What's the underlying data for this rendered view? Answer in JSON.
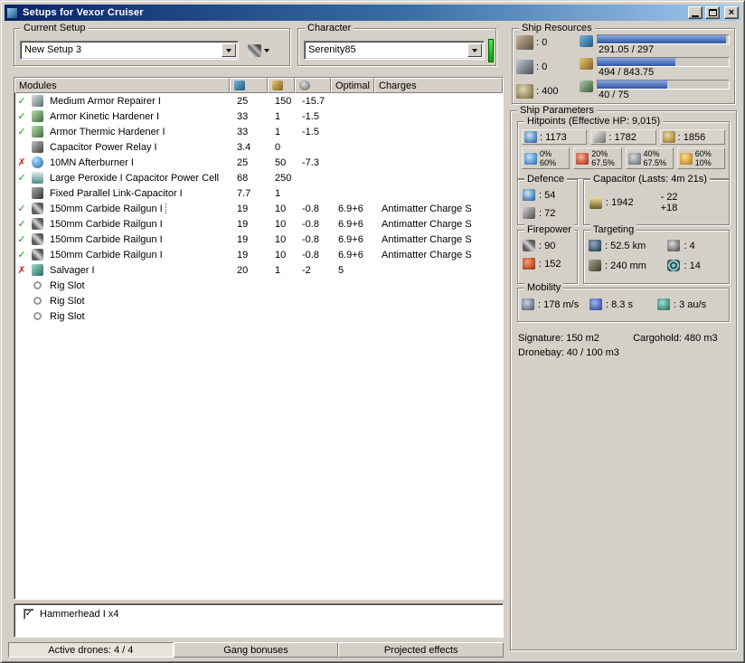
{
  "window": {
    "title": "Setups for Vexor Cruiser"
  },
  "toolbar": {
    "current_setup_label": "Current Setup",
    "current_setup_value": "New Setup 3",
    "character_label": "Character",
    "character_value": "Serenity85"
  },
  "modules": {
    "columns": {
      "name": "Modules",
      "cpu_icon": "cpu-icon",
      "pg_icon": "powergrid-icon",
      "cap_icon": "capacitor-col-icon",
      "optimal": "Optimal",
      "charges": "Charges"
    },
    "rows": [
      {
        "status": "on",
        "icon": "armor-repairer-icon",
        "name": "Medium Armor Repairer I",
        "cpu": "25",
        "pg": "150",
        "cap": "-15.7",
        "optimal": "",
        "charges": "",
        "selected": false
      },
      {
        "status": "on",
        "icon": "armor-hardener-icon",
        "name": "Armor Kinetic Hardener I",
        "cpu": "33",
        "pg": "1",
        "cap": "-1.5",
        "optimal": "",
        "charges": "",
        "selected": false
      },
      {
        "status": "on",
        "icon": "armor-hardener-icon",
        "name": "Armor Thermic Hardener I",
        "cpu": "33",
        "pg": "1",
        "cap": "-1.5",
        "optimal": "",
        "charges": "",
        "selected": false
      },
      {
        "status": "none",
        "icon": "power-relay-icon",
        "name": "Capacitor Power Relay I",
        "cpu": "3.4",
        "pg": "0",
        "cap": "",
        "optimal": "",
        "charges": "",
        "selected": false
      },
      {
        "status": "off",
        "icon": "afterburner-icon",
        "name": "10MN Afterburner I",
        "cpu": "25",
        "pg": "50",
        "cap": "-7.3",
        "optimal": "",
        "charges": "",
        "selected": false
      },
      {
        "status": "on",
        "icon": "power-cell-icon",
        "name": "Large Peroxide I Capacitor Power Cell",
        "cpu": "68",
        "pg": "250",
        "cap": "",
        "optimal": "",
        "charges": "",
        "selected": false
      },
      {
        "status": "none",
        "icon": "link-capacitor-icon",
        "name": "Fixed Parallel Link-Capacitor I",
        "cpu": "7.7",
        "pg": "1",
        "cap": "",
        "optimal": "",
        "charges": "",
        "selected": false
      },
      {
        "status": "on",
        "icon": "railgun-icon",
        "name": "150mm Carbide Railgun I",
        "cpu": "19",
        "pg": "10",
        "cap": "-0.8",
        "optimal": "6.9+6",
        "charges": "Antimatter Charge S",
        "selected": true
      },
      {
        "status": "on",
        "icon": "railgun-icon",
        "name": "150mm Carbide Railgun I",
        "cpu": "19",
        "pg": "10",
        "cap": "-0.8",
        "optimal": "6.9+6",
        "charges": "Antimatter Charge S",
        "selected": false
      },
      {
        "status": "on",
        "icon": "railgun-icon",
        "name": "150mm Carbide Railgun I",
        "cpu": "19",
        "pg": "10",
        "cap": "-0.8",
        "optimal": "6.9+6",
        "charges": "Antimatter Charge S",
        "selected": false
      },
      {
        "status": "on",
        "icon": "railgun-icon",
        "name": "150mm Carbide Railgun I",
        "cpu": "19",
        "pg": "10",
        "cap": "-0.8",
        "optimal": "6.9+6",
        "charges": "Antimatter Charge S",
        "selected": false
      },
      {
        "status": "off",
        "icon": "salvager-icon",
        "name": "Salvager I",
        "cpu": "20",
        "pg": "1",
        "cap": "-2",
        "optimal": "5",
        "charges": "",
        "selected": false
      },
      {
        "status": "none",
        "icon": "rig-slot-icon",
        "name": "Rig Slot",
        "cpu": "",
        "pg": "",
        "cap": "",
        "optimal": "",
        "charges": "",
        "selected": false
      },
      {
        "status": "none",
        "icon": "rig-slot-icon",
        "name": "Rig Slot",
        "cpu": "",
        "pg": "",
        "cap": "",
        "optimal": "",
        "charges": "",
        "selected": false
      },
      {
        "status": "none",
        "icon": "rig-slot-icon",
        "name": "Rig Slot",
        "cpu": "",
        "pg": "",
        "cap": "",
        "optimal": "",
        "charges": "",
        "selected": false
      }
    ]
  },
  "drones": {
    "items": [
      {
        "checked": true,
        "label": "Hammerhead I x4"
      }
    ]
  },
  "statusbar": {
    "active_tab": 0,
    "tabs": [
      "Active drones: 4 / 4",
      "Gang bonuses",
      "Projected effects"
    ]
  },
  "ship_resources": {
    "label": "Ship Resources",
    "slots": [
      {
        "icon": "turret-hardpoints-icon",
        "value": ": 0"
      },
      {
        "icon": "launcher-hardpoints-icon",
        "value": ": 0"
      },
      {
        "icon": "calibration-icon",
        "value": ": 400"
      }
    ],
    "bars": [
      {
        "icon": "cpu-icon",
        "text": "291.05 / 297",
        "pct": 98
      },
      {
        "icon": "powergrid-icon",
        "text": "494 / 843.75",
        "pct": 59
      },
      {
        "icon": "drone-bandwidth-icon",
        "text": "40 / 75",
        "pct": 53
      }
    ]
  },
  "ship_parameters": {
    "label": "Ship Parameters",
    "hitpoints": {
      "label": "Hitpoints (Effective HP: 9,015)",
      "stats": [
        {
          "icon": "shield-icon",
          "value": ": 1173"
        },
        {
          "icon": "armor-icon",
          "value": ": 1782"
        },
        {
          "icon": "structure-icon",
          "value": ": 1856"
        }
      ],
      "resists": [
        {
          "icon": "em-damage-icon",
          "shield": "0%",
          "armor": "60%"
        },
        {
          "icon": "thermal-damage-icon",
          "shield": "20%",
          "armor": "67.5%"
        },
        {
          "icon": "kinetic-damage-icon",
          "shield": "40%",
          "armor": "67.5%"
        },
        {
          "icon": "explosive-damage-icon",
          "shield": "60%",
          "armor": "10%"
        }
      ]
    },
    "defence": {
      "label": "Defence",
      "rows": [
        {
          "icon": "shield-recharge-icon",
          "value": ": 54"
        },
        {
          "icon": "armor-repair-icon",
          "value": ": 72"
        }
      ]
    },
    "capacitor": {
      "label": "Capacitor (Lasts: 4m 21s)",
      "icon": "capacitor-charge-icon",
      "value": ": 1942",
      "drain": "- 22",
      "recharge": "+18"
    },
    "firepower": {
      "label": "Firepower",
      "rows": [
        {
          "icon": "volley-icon",
          "value": ": 90"
        },
        {
          "icon": "dps-icon",
          "value": ": 152"
        }
      ]
    },
    "targeting": {
      "label": "Targeting",
      "cells": [
        {
          "icon": "target-range-icon",
          "value": ": 52.5 km"
        },
        {
          "icon": "max-targets-icon",
          "value": ": 4"
        },
        {
          "icon": "scan-resolution-icon",
          "value": ": 240 mm"
        },
        {
          "icon": "sensor-strength-icon",
          "value": ": 14"
        }
      ]
    },
    "mobility": {
      "label": "Mobility",
      "cells": [
        {
          "icon": "max-velocity-icon",
          "value": ": 178 m/s"
        },
        {
          "icon": "align-time-icon",
          "value": ": 8.3 s"
        },
        {
          "icon": "warp-speed-icon",
          "value": ": 3 au/s"
        }
      ]
    },
    "signature": "Signature: 150 m2",
    "cargohold": "Cargohold: 480 m3",
    "dronebay": "Dronebay: 40 / 100 m3"
  }
}
